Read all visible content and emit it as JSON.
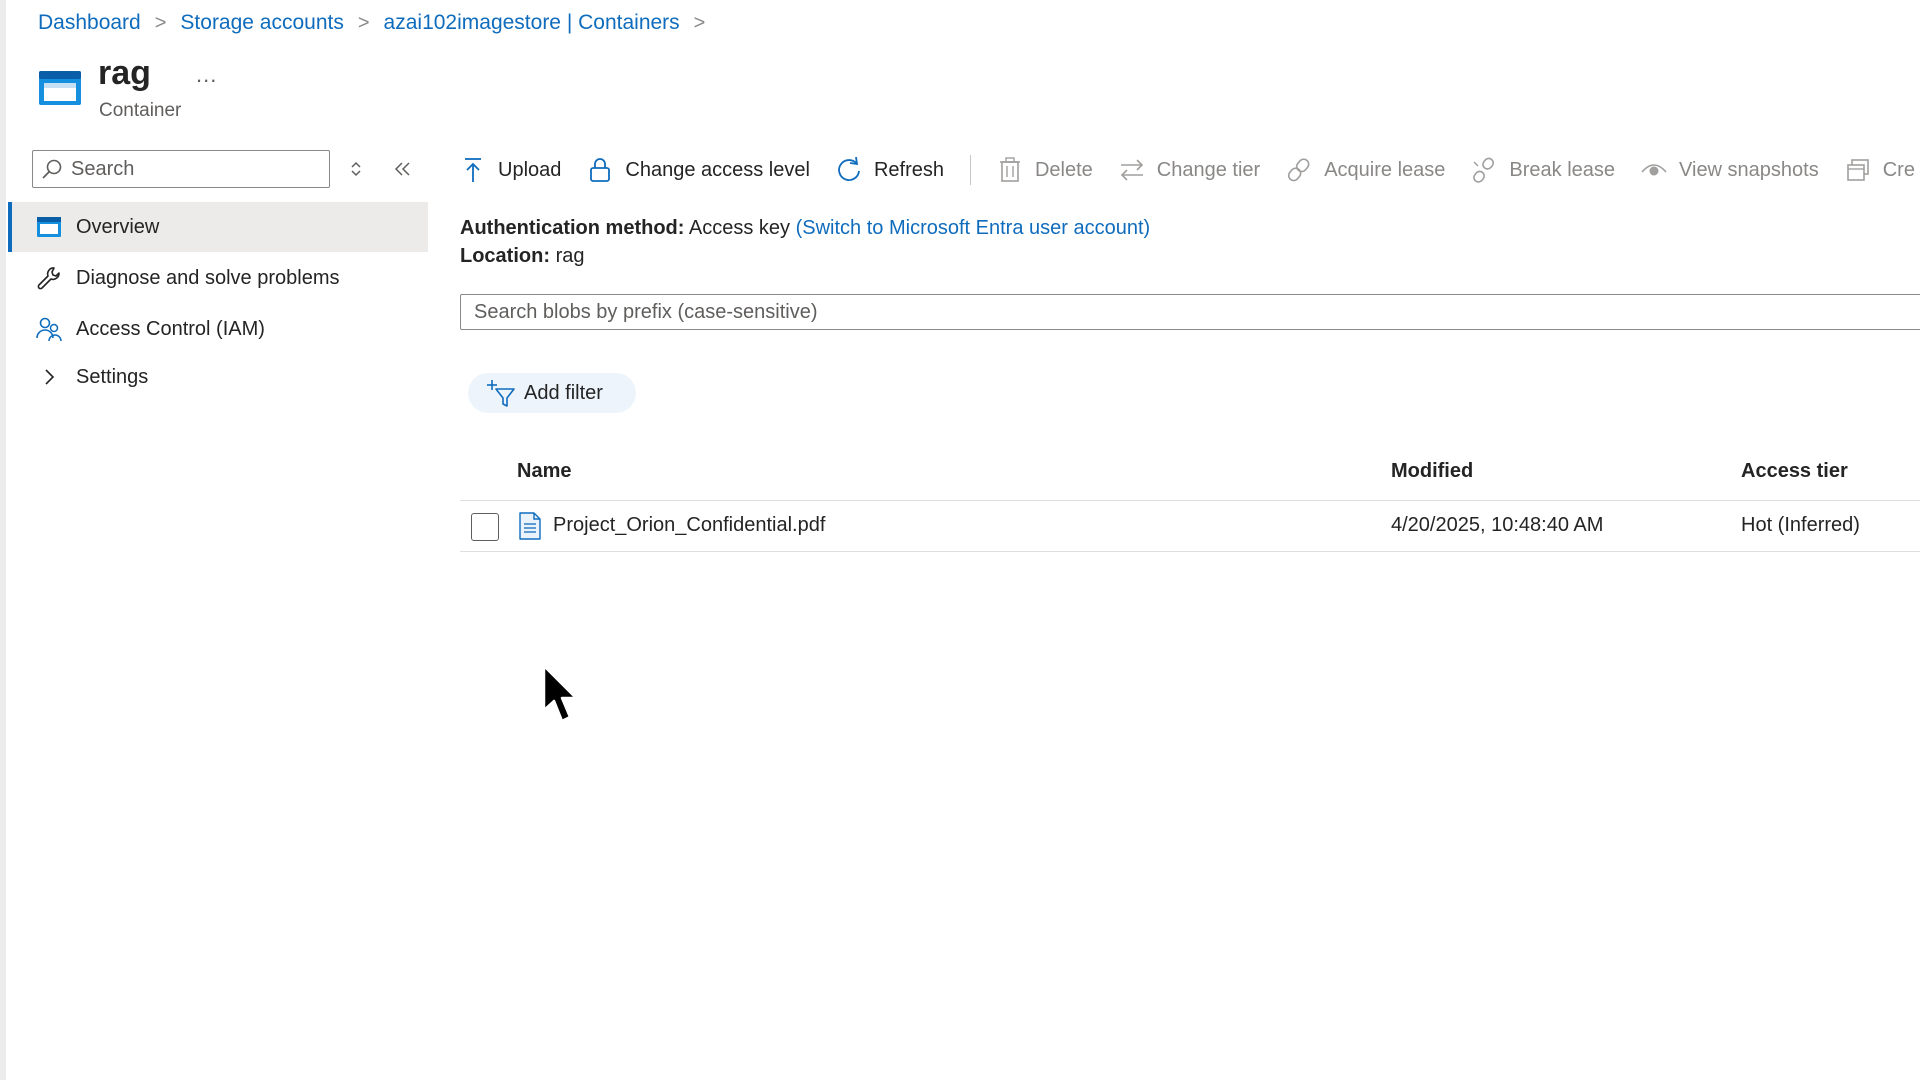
{
  "breadcrumb": {
    "items": [
      "Dashboard",
      "Storage accounts",
      "azai102imagestore | Containers"
    ],
    "separator": ">"
  },
  "header": {
    "title": "rag",
    "more": "...",
    "subtitle": "Container",
    "icon": "container-icon"
  },
  "sidebar": {
    "search_placeholder": "Search",
    "items": [
      {
        "label": "Overview",
        "icon": "overview-icon",
        "active": true
      },
      {
        "label": "Diagnose and solve problems",
        "icon": "wrench-icon"
      },
      {
        "label": "Access Control (IAM)",
        "icon": "people-icon"
      },
      {
        "label": "Settings",
        "icon": "chevron-right-icon"
      }
    ]
  },
  "toolbar": {
    "upload": "Upload",
    "change_access_level": "Change access level",
    "refresh": "Refresh",
    "delete": "Delete",
    "change_tier": "Change tier",
    "acquire_lease": "Acquire lease",
    "break_lease": "Break lease",
    "view_snapshots": "View snapshots",
    "create_snapshot": "Cre"
  },
  "info": {
    "auth_label": "Authentication method:",
    "auth_value": "Access key",
    "auth_link": "(Switch to Microsoft Entra user account)",
    "location_label": "Location:",
    "location_value": "rag"
  },
  "blob_search": {
    "placeholder": "Search blobs by prefix (case-sensitive)"
  },
  "filter": {
    "add_filter": "Add filter"
  },
  "table": {
    "columns": [
      "Name",
      "Modified",
      "Access tier"
    ],
    "rows": [
      {
        "name": "Project_Orion_Confidential.pdf",
        "modified": "4/20/2025, 10:48:40 AM",
        "access_tier": "Hot (Inferred)"
      }
    ]
  },
  "colors": {
    "link": "#0f6cbd",
    "active_nav_bg": "#edebe9",
    "filter_pill_bg": "#edf4fb",
    "container_icon": "#1490df"
  }
}
